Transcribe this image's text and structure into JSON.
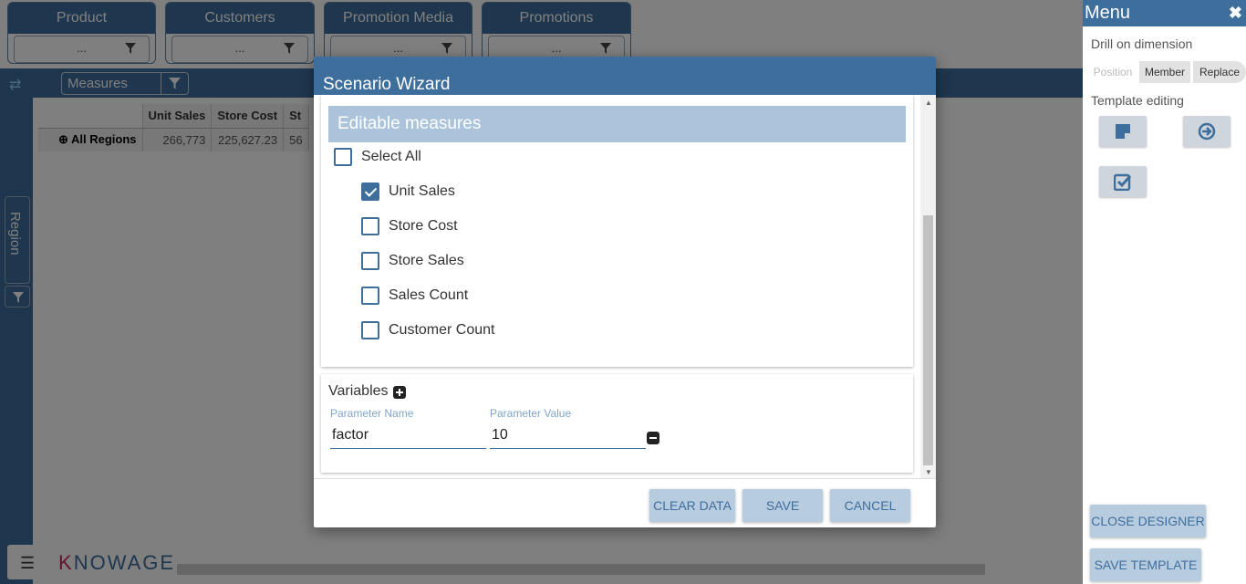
{
  "filters": [
    {
      "title": "Product",
      "value": "..."
    },
    {
      "title": "Customers",
      "value": "..."
    },
    {
      "title": "Promotion Media",
      "value": "..."
    },
    {
      "title": "Promotions",
      "value": "..."
    }
  ],
  "toolbar": {
    "measures_label": "Measures"
  },
  "axis": {
    "region_label": "Region"
  },
  "pivot": {
    "headers": [
      "Unit Sales",
      "Store Cost",
      "St"
    ],
    "row_label": "All Regions",
    "values": [
      "266,773",
      "225,627.23",
      "56"
    ]
  },
  "logo": {
    "text": "KNOWAGE"
  },
  "menu": {
    "title": "Menu",
    "drill_label": "Drill on dimension",
    "position_label": "Position",
    "member_label": "Member",
    "replace_label": "Replace",
    "template_label": "Template editing",
    "close_designer": "CLOSE DESIGNER",
    "save_template": "SAVE TEMPLATE"
  },
  "dialog": {
    "title": "Scenario Wizard",
    "section_title": "Editable measures",
    "select_all": "Select All",
    "measures": [
      {
        "label": "Unit Sales",
        "checked": true
      },
      {
        "label": "Store Cost",
        "checked": false
      },
      {
        "label": "Store Sales",
        "checked": false
      },
      {
        "label": "Sales Count",
        "checked": false
      },
      {
        "label": "Customer Count",
        "checked": false
      }
    ],
    "variables_title": "Variables",
    "param_name_label": "Parameter Name",
    "param_value_label": "Parameter Value",
    "param_name": "factor",
    "param_value": "10",
    "clear_data": "CLEAR DATA",
    "save": "SAVE",
    "cancel": "CANCEL"
  },
  "colors": {
    "primary": "#3d6e9c",
    "section_header": "#abc4dc",
    "button_bg": "#b8cce0"
  }
}
